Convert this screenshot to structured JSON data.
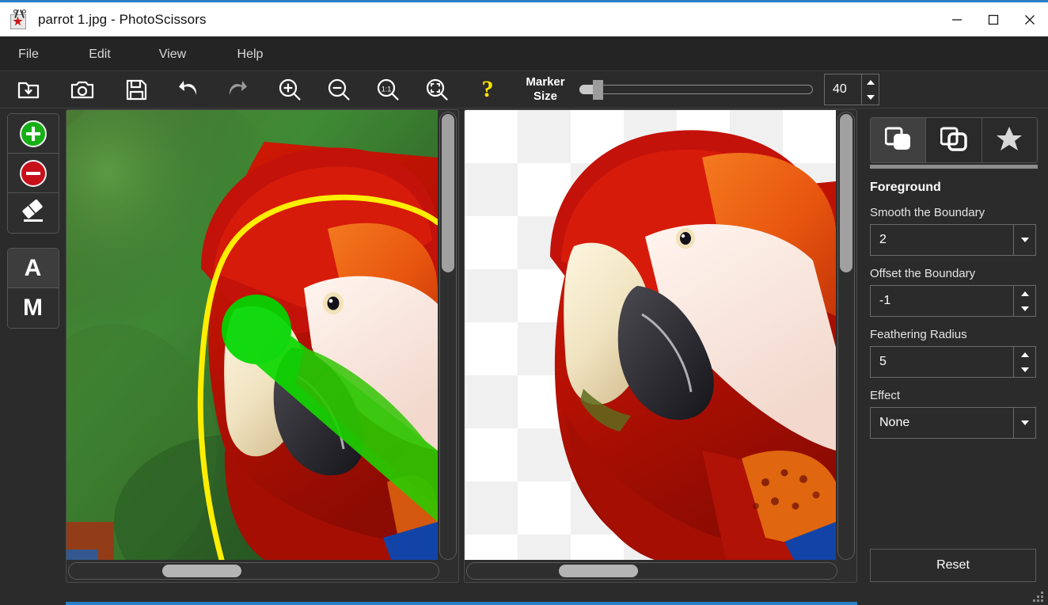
{
  "window": {
    "title": "parrot 1.jpg - PhotoScissors",
    "app_icon": "scissors-star-icon",
    "minimize_label": "Minimize",
    "maximize_label": "Maximize",
    "close_label": "Close"
  },
  "menubar": {
    "items": [
      {
        "label": "File"
      },
      {
        "label": "Edit"
      },
      {
        "label": "View"
      },
      {
        "label": "Help"
      }
    ]
  },
  "toolbar": {
    "buttons": [
      {
        "name": "open-image-button",
        "icon": "folder-download-icon",
        "label": "Open Image"
      },
      {
        "name": "capture-button",
        "icon": "camera-icon",
        "label": "Capture"
      },
      {
        "name": "save-button",
        "icon": "floppy-save-icon",
        "label": "Save"
      },
      {
        "name": "undo-button",
        "icon": "undo-arrow-icon",
        "label": "Undo"
      },
      {
        "name": "redo-button",
        "icon": "redo-arrow-icon",
        "label": "Redo"
      },
      {
        "name": "zoom-in-button",
        "icon": "magnifier-plus-icon",
        "label": "Zoom In"
      },
      {
        "name": "zoom-out-button",
        "icon": "magnifier-minus-icon",
        "label": "Zoom Out"
      },
      {
        "name": "zoom-actual-button",
        "icon": "magnifier-1-to-1-icon",
        "label": "Actual Size"
      },
      {
        "name": "zoom-fit-button",
        "icon": "magnifier-fit-icon",
        "label": "Fit to Window"
      },
      {
        "name": "help-button",
        "icon": "question-mark-icon",
        "label": "?"
      }
    ],
    "marker_size": {
      "label_line1": "Marker",
      "label_line2": "Size",
      "value": "40",
      "min": 1,
      "max": 500,
      "percent": 6
    }
  },
  "tool_rail": {
    "groups": [
      {
        "name": "marker-tools",
        "items": [
          {
            "name": "foreground-marker-button",
            "icon": "circle-plus-icon",
            "label": "Mark Foreground",
            "active": false
          },
          {
            "name": "background-marker-button",
            "icon": "circle-minus-icon",
            "label": "Mark Background",
            "active": false
          },
          {
            "name": "eraser-button",
            "icon": "eraser-icon",
            "label": "Eraser",
            "active": false
          }
        ]
      },
      {
        "name": "mode-tools",
        "items": [
          {
            "name": "auto-mode-button",
            "icon": "letter-a-icon",
            "label": "A",
            "active": true
          },
          {
            "name": "manual-mode-button",
            "icon": "letter-m-icon",
            "label": "M",
            "active": false
          }
        ]
      }
    ]
  },
  "panels": {
    "source": {
      "name": "source-image-panel",
      "image_alt": "parrot 1.jpg with yellow selection outline and green foreground marker strokes",
      "vscroll_label": "Vertical scrollbar",
      "hscroll_label": "Horizontal scrollbar"
    },
    "result": {
      "name": "result-image-panel",
      "image_alt": "Cut-out parrot on transparent checkerboard background",
      "vscroll_label": "Vertical scrollbar",
      "hscroll_label": "Horizontal scrollbar"
    }
  },
  "settings": {
    "tabs": [
      {
        "name": "tab-foreground",
        "icon": "layers-filled-icon",
        "active": true
      },
      {
        "name": "tab-background",
        "icon": "layers-outline-icon",
        "active": false
      },
      {
        "name": "tab-effects",
        "icon": "star-icon",
        "active": false
      }
    ],
    "section_title": "Foreground",
    "fields": [
      {
        "name": "smooth-the-boundary",
        "label": "Smooth the Boundary",
        "value": "2",
        "control": "dropdown"
      },
      {
        "name": "offset-the-boundary",
        "label": "Offset the Boundary",
        "value": "-1",
        "control": "spinner"
      },
      {
        "name": "feathering-radius",
        "label": "Feathering Radius",
        "value": "5",
        "control": "spinner"
      },
      {
        "name": "effect",
        "label": "Effect",
        "value": "None",
        "control": "dropdown"
      }
    ],
    "reset_label": "Reset"
  },
  "colors": {
    "accent_border": "#2a7fc4",
    "chrome_dark": "#2b2b2b",
    "menu_dark": "#242424",
    "help_yellow": "#ffe400",
    "marker_foreground_green": "#16b016",
    "marker_background_red": "#c8101b",
    "selection_outline_yellow": "#ffee00"
  }
}
